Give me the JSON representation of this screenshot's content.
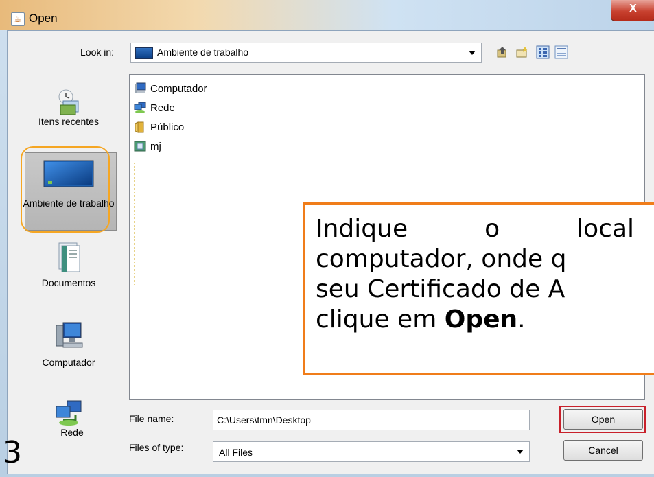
{
  "window": {
    "title": "Open",
    "close_label": "X"
  },
  "look_in": {
    "label": "Look in:",
    "value": "Ambiente de trabalho"
  },
  "places": [
    {
      "label": "Itens recentes",
      "icon": "recent-items-icon"
    },
    {
      "label": "Ambiente de trabalho",
      "icon": "desktop-icon",
      "selected": true
    },
    {
      "label": "Documentos",
      "icon": "documents-icon"
    },
    {
      "label": "Computador",
      "icon": "computer-icon"
    },
    {
      "label": "Rede",
      "icon": "network-icon"
    }
  ],
  "files": [
    {
      "name": "Computador",
      "icon": "computer-icon"
    },
    {
      "name": "Rede",
      "icon": "network-icon"
    },
    {
      "name": "Público",
      "icon": "folder-icon"
    },
    {
      "name": "mj",
      "icon": "user-folder-icon"
    }
  ],
  "callout": {
    "line1_word1": "Indique",
    "line1_word2": "o",
    "line1_word3": "local",
    "line2": "computador, onde q",
    "line3": "seu Certificado de A",
    "line4_prefix": "clique em ",
    "line4_bold": "Open",
    "line4_suffix": "."
  },
  "file_name": {
    "label": "File name:",
    "value": "C:\\Users\\tmn\\Desktop"
  },
  "file_type": {
    "label": "Files of type:",
    "value": "All Files"
  },
  "buttons": {
    "open": "Open",
    "cancel": "Cancel"
  },
  "slide_number": "3",
  "colors": {
    "callout_border": "#f07d1a",
    "highlight_oval": "#f5a623",
    "open_outline": "#c8202a"
  }
}
